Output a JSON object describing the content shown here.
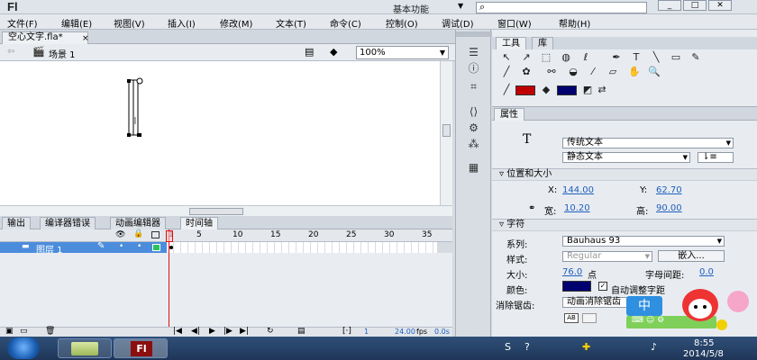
{
  "app": {
    "logo": "Fl",
    "workspace": "基本功能",
    "window_buttons": [
      "_",
      "□",
      "✕"
    ]
  },
  "menu": [
    "文件(F)",
    "编辑(E)",
    "视图(V)",
    "插入(I)",
    "修改(M)",
    "文本(T)",
    "命令(C)",
    "控制(O)",
    "调试(D)",
    "窗口(W)",
    "帮助(H)"
  ],
  "document": {
    "tab_label": "空心文字.fla*",
    "close": "×",
    "scene": "场景 1",
    "zoom": "100%"
  },
  "panel_tabs": [
    "输出",
    "编译器错误",
    "动画编辑器",
    "时间轴"
  ],
  "timeline": {
    "frame_numbers": [
      "1",
      "5",
      "10",
      "15",
      "20",
      "25",
      "30",
      "35"
    ],
    "layer_name": "图层 1",
    "current_frame": "1",
    "fps": "24.00",
    "fps_unit": "fps",
    "time": "0.0s"
  },
  "tools": {
    "tabs": [
      "工具",
      "库"
    ]
  },
  "colors": {
    "stroke": "#c00000",
    "fill": "#00006e",
    "layer_highlight": "#4c8cdc"
  },
  "properties": {
    "tab": "属性",
    "text_engine": "传统文本",
    "text_type": "静态文本",
    "section_position": "位置和大小",
    "x_label": "X:",
    "x_value": "144.00",
    "y_label": "Y:",
    "y_value": "62.70",
    "width_label": "宽:",
    "width_value": "10.20",
    "height_label": "高:",
    "height_value": "90.00",
    "section_character": "字符",
    "family_label": "系列:",
    "family_value": "Bauhaus 93",
    "style_label": "样式:",
    "style_value": "Regular",
    "embed_button": "嵌入...",
    "size_label": "大小:",
    "size_value": "76.0",
    "size_unit": "点",
    "spacing_label": "字母间距:",
    "spacing_value": "0.0",
    "color_label": "颜色:",
    "autokern_label": "自动调整字距",
    "antialias_label": "消除锯齿:",
    "antialias_value": "动画消除锯齿"
  },
  "taskbar": {
    "time": "8:55",
    "date": "2014/5/8",
    "ime_label": "中"
  }
}
